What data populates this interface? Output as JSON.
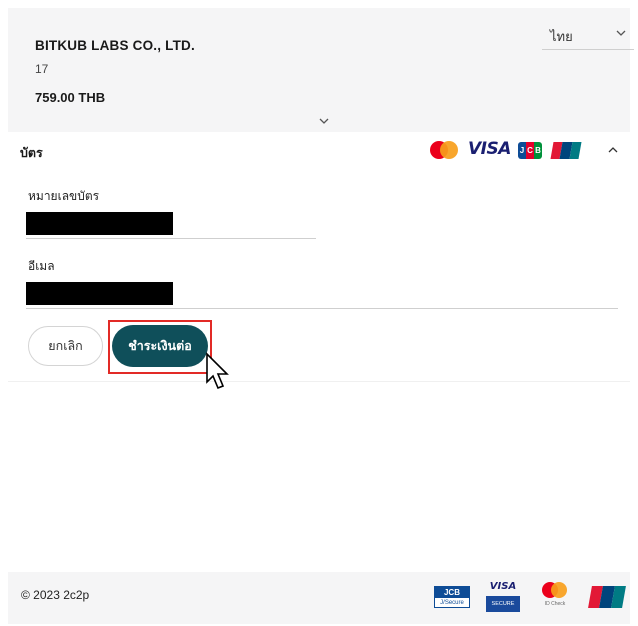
{
  "header": {
    "language": "ไทย",
    "merchant_name": "BITKUB LABS CO., LTD.",
    "reference": "17",
    "amount": "759.00 THB"
  },
  "card_section": {
    "title": "บัตร",
    "brands": [
      "mastercard",
      "VISA",
      "JCB",
      "UnionPay"
    ],
    "visa_text": "VISA",
    "jcb_letters": [
      "J",
      "C",
      "B"
    ],
    "card_number_label": "หมายเลขบัตร",
    "email_label": "อีเมล"
  },
  "actions": {
    "cancel_label": "ยกเลิก",
    "pay_label": "ชำระเงินต่อ"
  },
  "footer": {
    "copyright": "© 2023 2c2p",
    "jcb_secure_top": "JCB",
    "jcb_secure_bottom": "J/Secure",
    "visa_secure_top": "VISA",
    "visa_secure_bottom": "SECURE",
    "mc_id_check": "ID Check"
  },
  "colors": {
    "primary": "#0f4f5a",
    "highlight": "#e22a26",
    "panel": "#f5f5f6"
  }
}
